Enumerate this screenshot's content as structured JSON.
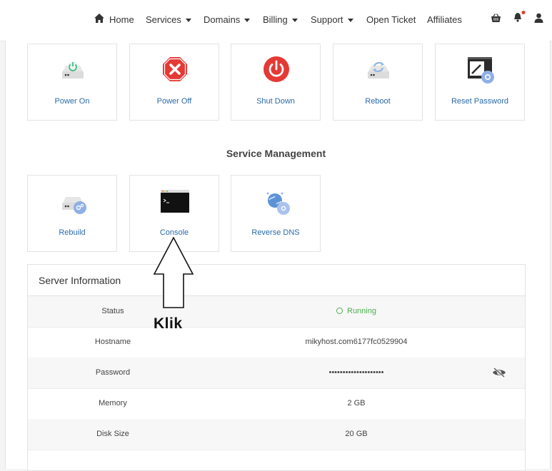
{
  "nav": {
    "items": [
      {
        "label": "Home",
        "caret": false
      },
      {
        "label": "Services",
        "caret": true
      },
      {
        "label": "Domains",
        "caret": true
      },
      {
        "label": "Billing",
        "caret": true
      },
      {
        "label": "Support",
        "caret": true
      },
      {
        "label": "Open Ticket",
        "caret": false
      },
      {
        "label": "Affiliates",
        "caret": false
      }
    ],
    "icons": [
      "basket-icon",
      "bell-icon",
      "user-icon"
    ],
    "notification_color": "#e53935"
  },
  "actions": [
    {
      "label": "Power On",
      "icon": "power-on-icon"
    },
    {
      "label": "Power Off",
      "icon": "power-off-icon"
    },
    {
      "label": "Shut Down",
      "icon": "shutdown-icon"
    },
    {
      "label": "Reboot",
      "icon": "reboot-icon"
    },
    {
      "label": "Reset Password",
      "icon": "reset-password-icon"
    }
  ],
  "management": {
    "title": "Service Management",
    "items": [
      {
        "label": "Rebuild",
        "icon": "rebuild-icon"
      },
      {
        "label": "Console",
        "icon": "console-icon"
      },
      {
        "label": "Reverse DNS",
        "icon": "reverse-dns-icon"
      }
    ]
  },
  "server": {
    "title": "Server Information",
    "rows": [
      {
        "key": "Status",
        "value": "Running"
      },
      {
        "key": "Hostname",
        "value": "mikyhost.com6177fc0529904"
      },
      {
        "key": "Password",
        "value": "••••••••••••••••••••"
      },
      {
        "key": "Memory",
        "value": "2 GB"
      },
      {
        "key": "Disk Size",
        "value": "20 GB"
      }
    ]
  },
  "annotation": {
    "text": "Klik"
  },
  "colors": {
    "link": "#2a6aa8",
    "danger": "#e53935",
    "success": "#4caf50"
  }
}
